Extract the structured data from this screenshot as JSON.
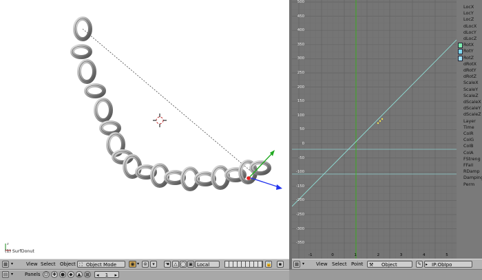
{
  "viewport": {
    "object_info": "(1) SurfDonut"
  },
  "ipo": {
    "y_ticks": [
      "500",
      "450",
      "400",
      "350",
      "300",
      "250",
      "200",
      "150",
      "100",
      "50",
      "0",
      "-50",
      "-100",
      "-150",
      "-200",
      "-250",
      "-300",
      "-350"
    ],
    "x_ticks": [
      "-1",
      "0",
      "1",
      "2",
      "3",
      "4",
      "5"
    ],
    "channels": [
      {
        "label": "LocX"
      },
      {
        "label": "LocY"
      },
      {
        "label": "LocZ"
      },
      {
        "label": "dLocX"
      },
      {
        "label": "dLocY"
      },
      {
        "label": "dLocZ"
      },
      {
        "label": "RotX",
        "swatch": "#7ff0b0"
      },
      {
        "label": "RotY",
        "swatch": "#7fd8f0"
      },
      {
        "label": "RotZ",
        "swatch": "#a0e0f8"
      },
      {
        "label": "dRotX"
      },
      {
        "label": "dRotY"
      },
      {
        "label": "dRotZ"
      },
      {
        "label": "ScaleX"
      },
      {
        "label": "ScaleY"
      },
      {
        "label": "ScaleZ"
      },
      {
        "label": "dScaleX"
      },
      {
        "label": "dScaleY"
      },
      {
        "label": "dScaleZ"
      },
      {
        "label": "Layer"
      },
      {
        "label": "Time"
      },
      {
        "label": "ColR"
      },
      {
        "label": "ColG"
      },
      {
        "label": "ColB"
      },
      {
        "label": "ColA"
      },
      {
        "label": "FStreng"
      },
      {
        "label": "FFall"
      },
      {
        "label": "RDamp"
      },
      {
        "label": "Damping"
      },
      {
        "label": "Perm"
      }
    ]
  },
  "view3d_header": {
    "view": "View",
    "select": "Select",
    "object": "Object",
    "mode": "Object Mode",
    "orientation": "Local"
  },
  "ipo_header": {
    "view": "View",
    "select": "Select",
    "point": "Point",
    "type": "Object",
    "ipo_name": "IP:ObIpo"
  },
  "buttons_header": {
    "panels": "Panels",
    "page": "1"
  },
  "colors": {
    "ipo_bg": "#757575",
    "grid_line": "#6a6a6a",
    "curve": "#8fe0d8",
    "frame_marker": "#3cb020"
  }
}
